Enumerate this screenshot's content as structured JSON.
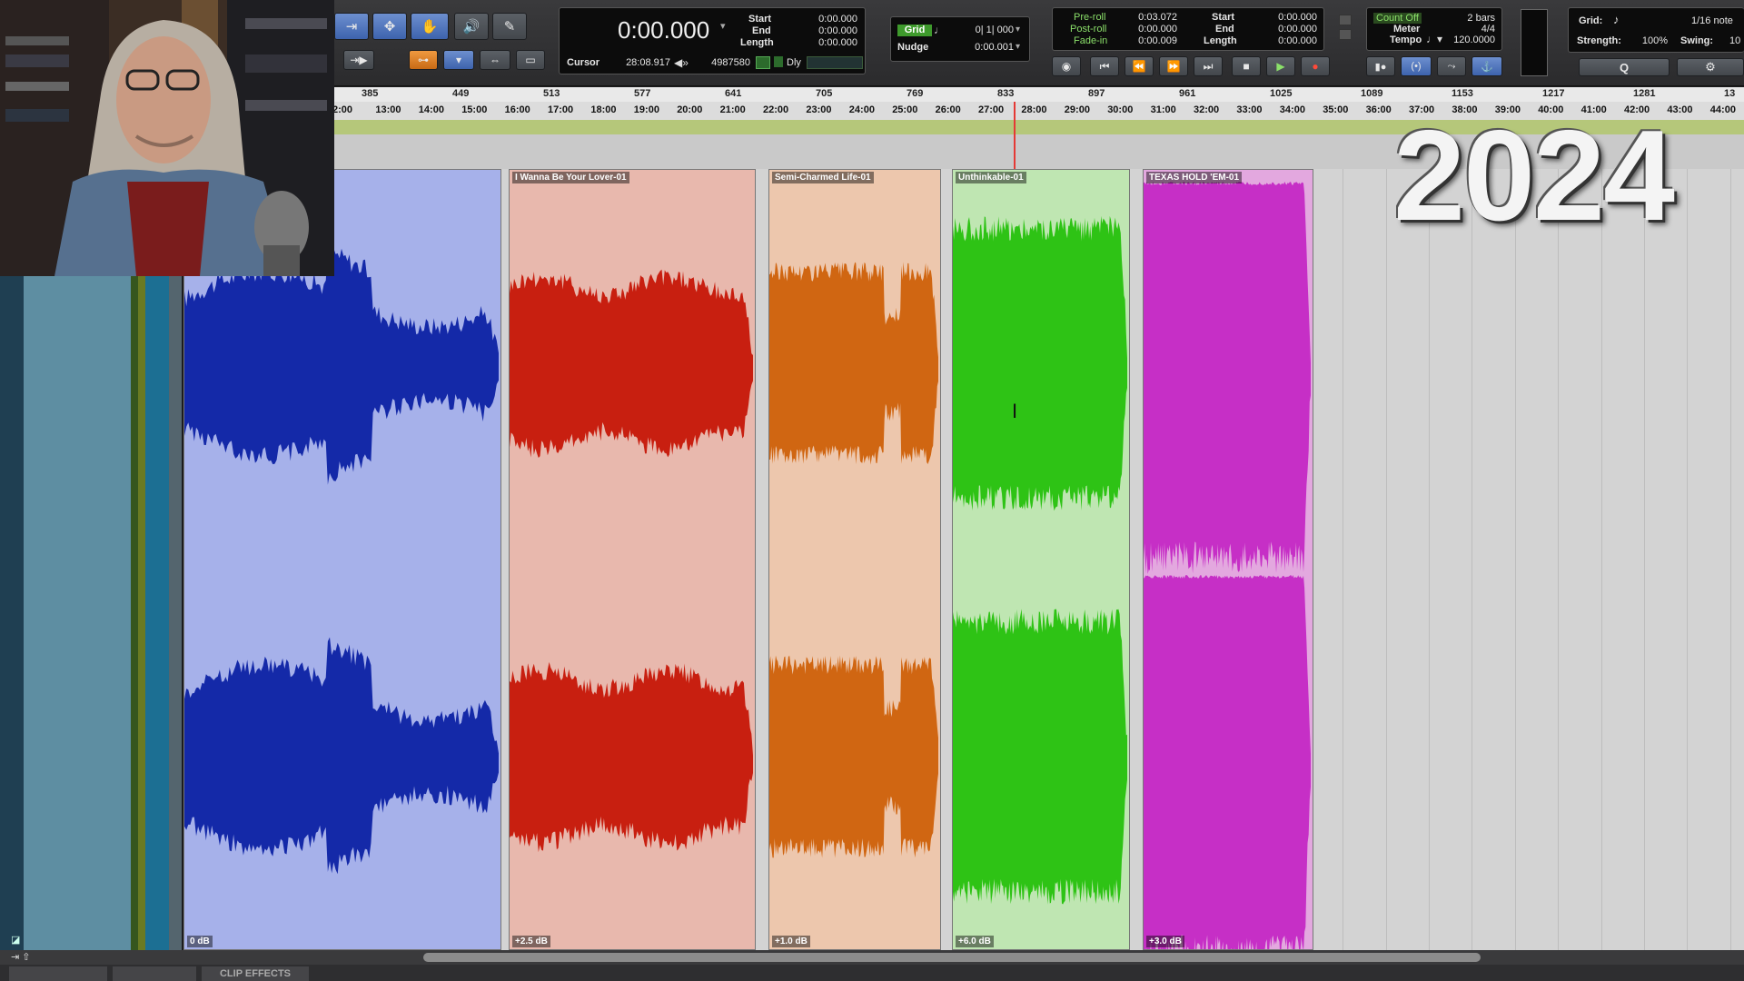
{
  "overlay": {
    "year": "2024"
  },
  "counter": {
    "main": "0:00.000",
    "start_label": "Start",
    "start": "0:00.000",
    "end_label": "End",
    "end": "0:00.000",
    "length_label": "Length",
    "length": "0:00.000",
    "cursor_label": "Cursor",
    "cursor": "28:08.917",
    "samples": "4987580",
    "dly": "Dly"
  },
  "grid_nudge": {
    "grid_label": "Grid",
    "grid_value": "0| 1| 000",
    "nudge_label": "Nudge",
    "nudge_value": "0:00.001"
  },
  "preroll": {
    "preroll_label": "Pre-roll",
    "preroll": "0:03.072",
    "postroll_label": "Post-roll",
    "postroll": "0:00.000",
    "fadein_label": "Fade-in",
    "fadein": "0:00.009",
    "start_label": "Start",
    "start": "0:00.000",
    "end_label": "End",
    "end": "0:00.000",
    "length_label": "Length",
    "length": "0:00.000"
  },
  "midi": {
    "countoff": "Count Off",
    "countoff_value": "2 bars",
    "meter_label": "Meter",
    "meter": "4/4",
    "tempo_label": "Tempo",
    "tempo": "120.0000"
  },
  "quantize": {
    "grid_label": "Grid:",
    "grid_value": "1/16 note",
    "strength_label": "Strength:",
    "strength": "100%",
    "swing_label": "Swing:",
    "swing": "10"
  },
  "ruler": {
    "bars": [
      "385",
      "449",
      "513",
      "577",
      "641",
      "705",
      "769",
      "833",
      "897",
      "961",
      "1025",
      "1089",
      "1153",
      "1217",
      "1281",
      "13"
    ],
    "times": [
      "2:00",
      "13:00",
      "14:00",
      "15:00",
      "16:00",
      "17:00",
      "18:00",
      "19:00",
      "20:00",
      "21:00",
      "22:00",
      "23:00",
      "24:00",
      "25:00",
      "26:00",
      "27:00",
      "28:00",
      "29:00",
      "30:00",
      "31:00",
      "32:00",
      "33:00",
      "34:00",
      "35:00",
      "36:00",
      "37:00",
      "38:00",
      "39:00",
      "40:00",
      "41:00",
      "42:00",
      "43:00",
      "44:00"
    ]
  },
  "clips": [
    {
      "name": "",
      "gain": "0 dB",
      "bg": "#a6b1ea",
      "wave": "#1429a8"
    },
    {
      "name": "I Wanna Be Your Lover-01",
      "gain": "+2.5 dB",
      "bg": "#e8b8ad",
      "wave": "#c81f10"
    },
    {
      "name": "Semi-Charmed Life-01",
      "gain": "+1.0 dB",
      "bg": "#edc7ad",
      "wave": "#d06612"
    },
    {
      "name": "Unthinkable-01",
      "gain": "+6.0 dB",
      "bg": "#bfe6b2",
      "wave": "#2ec315"
    },
    {
      "name": "TEXAS HOLD 'EM-01",
      "gain": "+3.0 dB",
      "bg": "#e3a8df",
      "wave": "#c62fc6"
    }
  ],
  "bottom": {
    "tab3": "CLIP EFFECTS"
  },
  "colors": {
    "playhead": "#e53935",
    "toolbar": "#2f2f31"
  }
}
